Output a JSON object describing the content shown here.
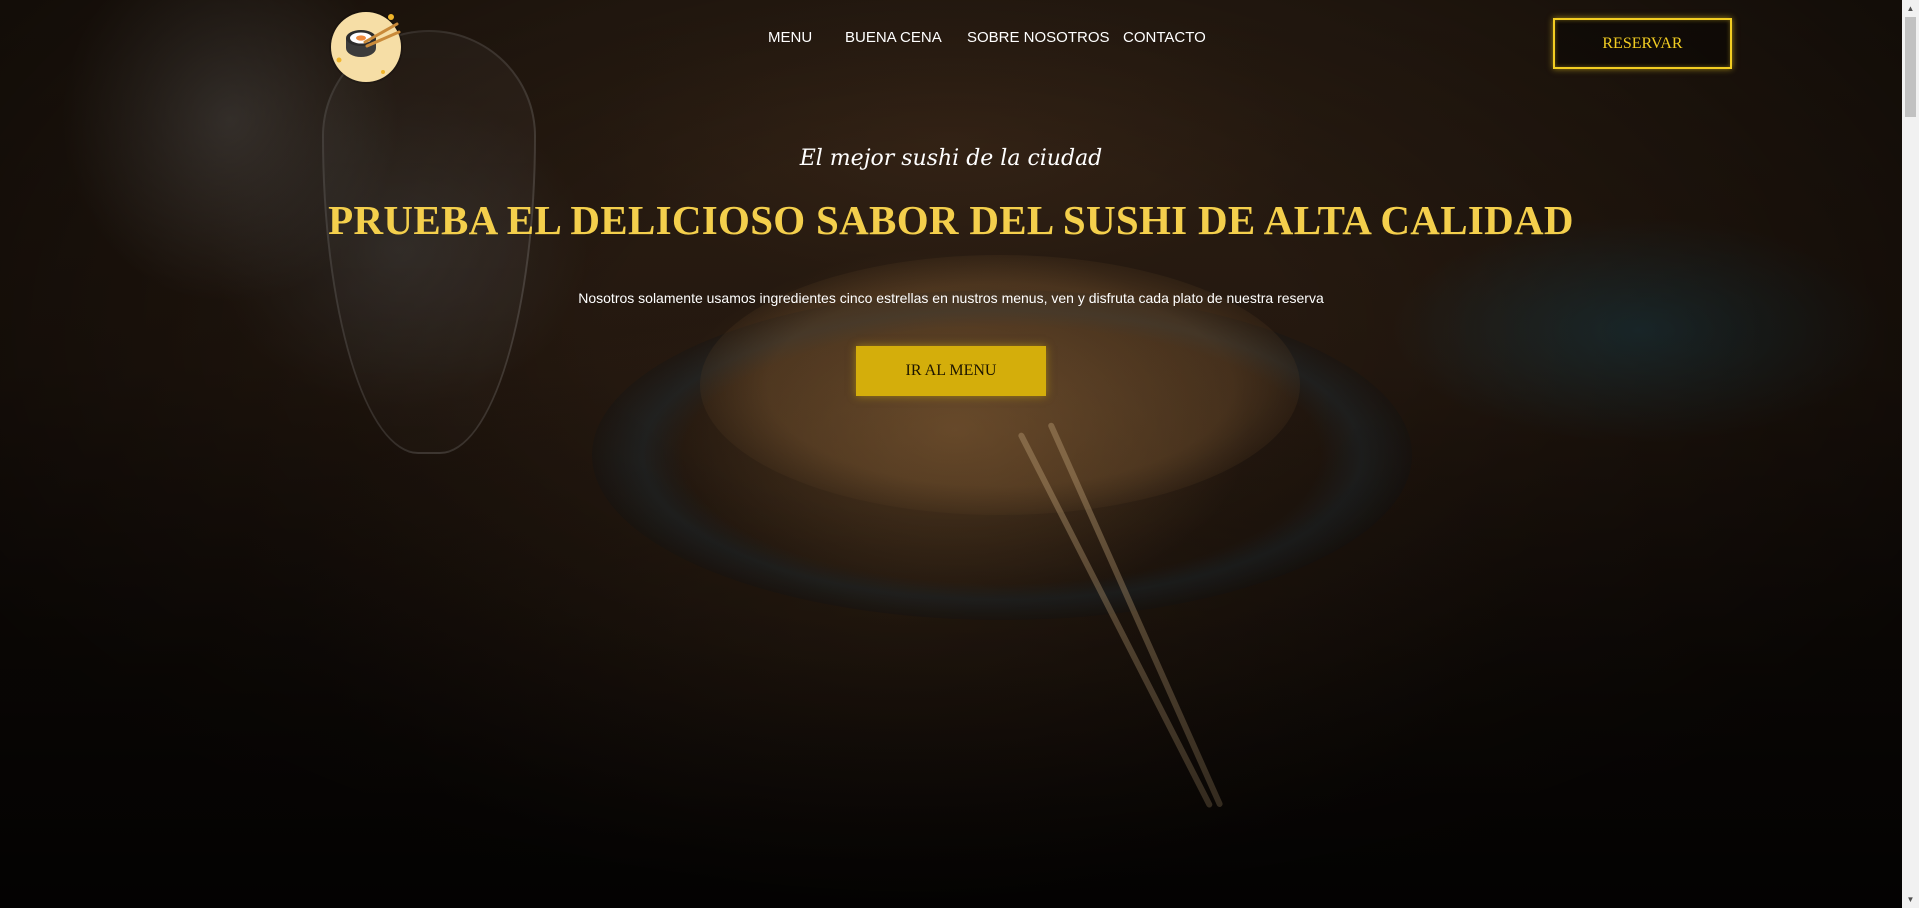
{
  "header": {
    "logo_icon": "sushi-roll-chopsticks-icon",
    "nav": [
      {
        "label": "MENU"
      },
      {
        "label": "BUENA CENA"
      },
      {
        "label": "SOBRE NOSOTROS"
      },
      {
        "label": "CONTACTO"
      }
    ],
    "reserve_label": "RESERVAR"
  },
  "hero": {
    "tagline": "El mejor sushi de la ciudad",
    "headline": "PRUEBA EL DELICIOSO SABOR DEL SUSHI DE ALTA CALIDAD",
    "subtext": "Nosotros solamente usamos ingredientes cinco estrellas en nustros menus, ven y disfruta cada plato de nuestra reserva",
    "cta_label": "IR AL MENU"
  },
  "colors": {
    "accent": "#f2cd22",
    "headline": "#f4cf4c",
    "cta_background": "#d4ae0b"
  },
  "scrollbar": {
    "up_icon": "scroll-up-arrow-icon",
    "down_icon": "scroll-down-arrow-icon"
  }
}
